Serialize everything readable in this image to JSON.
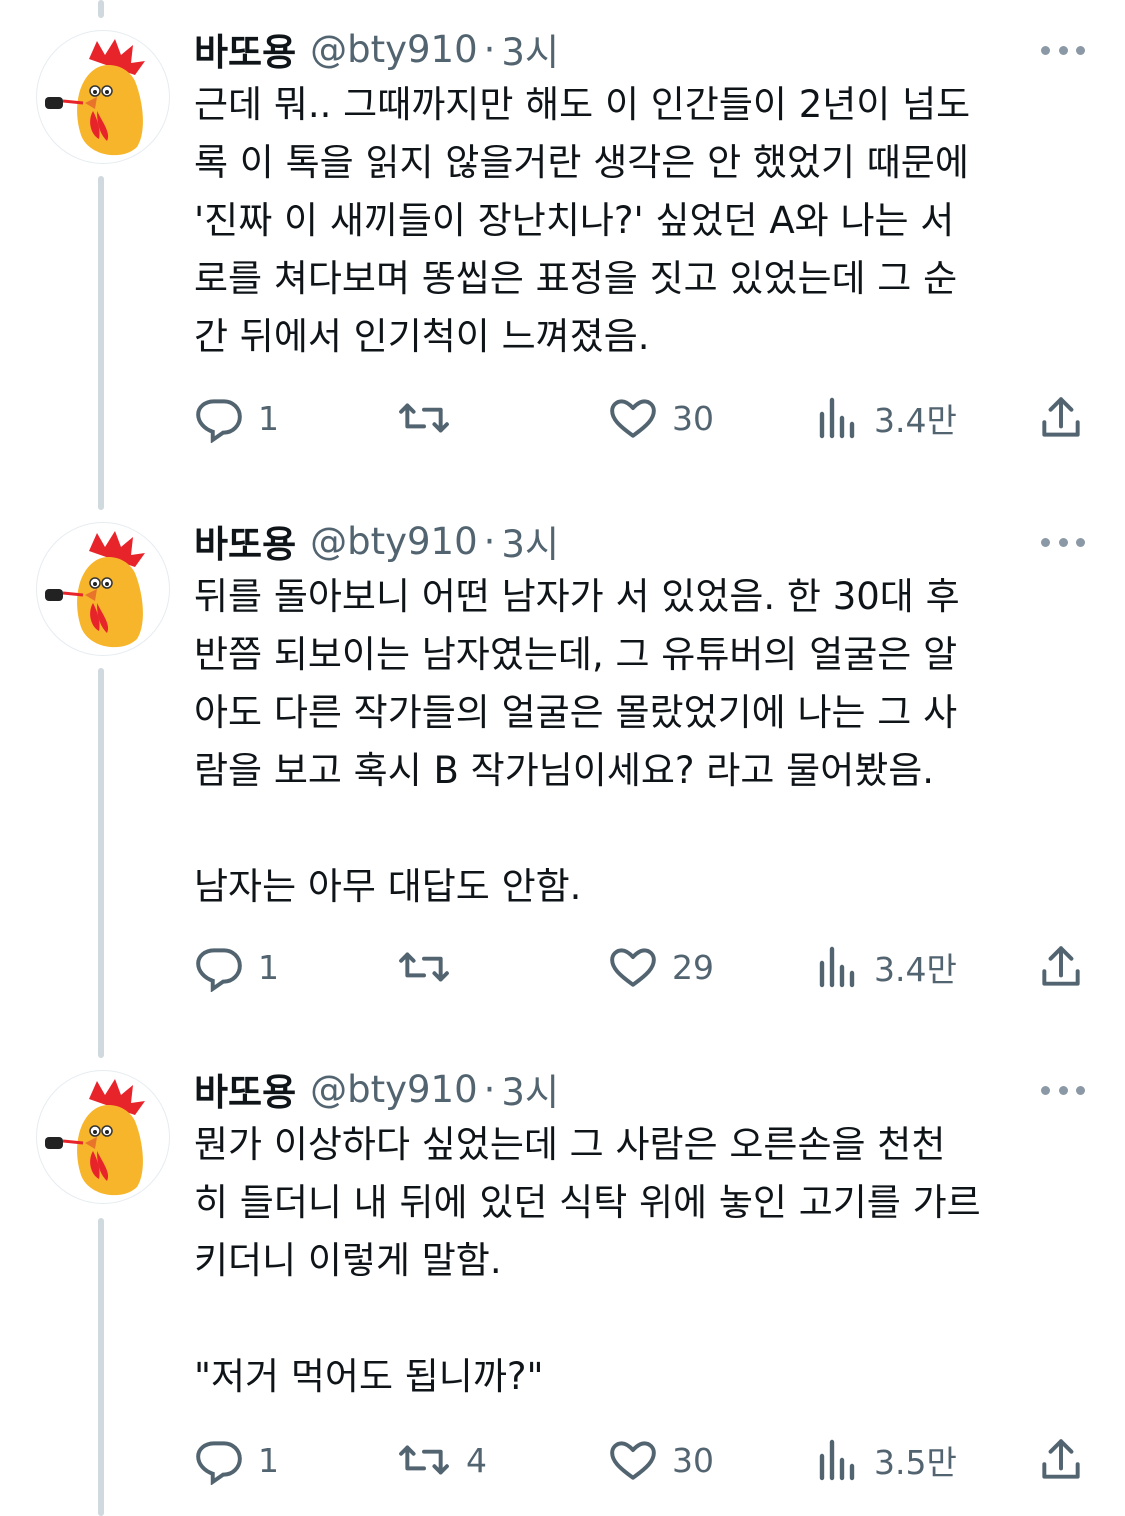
{
  "tweets": [
    {
      "name": "바또용",
      "handle": "@bty910",
      "separator": "·",
      "time": "3시",
      "text": "근데 뭐.. 그때까지만 해도 이 인간들이 2년이 넘도\n록 이 톡을 읽지 않을거란 생각은 안 했었기 때문에\n'진짜 이 새끼들이 장난치나?' 싶었던 A와 나는 서\n로를 쳐다보며 똥씹은 표정을 짓고 있었는데 그 순\n간 뒤에서 인기척이 느껴졌음.",
      "replies": "1",
      "retweets": "",
      "likes": "30",
      "views": "3.4만"
    },
    {
      "name": "바또용",
      "handle": "@bty910",
      "separator": "·",
      "time": "3시",
      "text": "뒤를 돌아보니 어떤 남자가 서 있었음. 한 30대 후\n반쯤 되보이는 남자였는데, 그 유튜버의 얼굴은 알\n아도 다른 작가들의 얼굴은 몰랐었기에 나는 그 사\n람을 보고 혹시 B 작가님이세요? 라고 물어봤음.\n\n남자는 아무 대답도 안함.",
      "replies": "1",
      "retweets": "",
      "likes": "29",
      "views": "3.4만"
    },
    {
      "name": "바또용",
      "handle": "@bty910",
      "separator": "·",
      "time": "3시",
      "text": "뭔가 이상하다 싶었는데 그 사람은 오른손을 천천\n히 들더니 내 뒤에 있던 식탁 위에 놓인 고기를 가르\n키더니 이렇게 말함.\n\n\"저거 먹어도 됩니까?\"",
      "replies": "1",
      "retweets": "4",
      "likes": "30",
      "views": "3.5만"
    }
  ],
  "icons": {
    "reply": "reply-icon",
    "retweet": "retweet-icon",
    "like": "heart-icon",
    "views": "views-icon",
    "share": "share-icon",
    "more": "more-icon"
  },
  "colors": {
    "text": "#0f1419",
    "secondary": "#536471",
    "thread_line": "#cfd9de"
  }
}
